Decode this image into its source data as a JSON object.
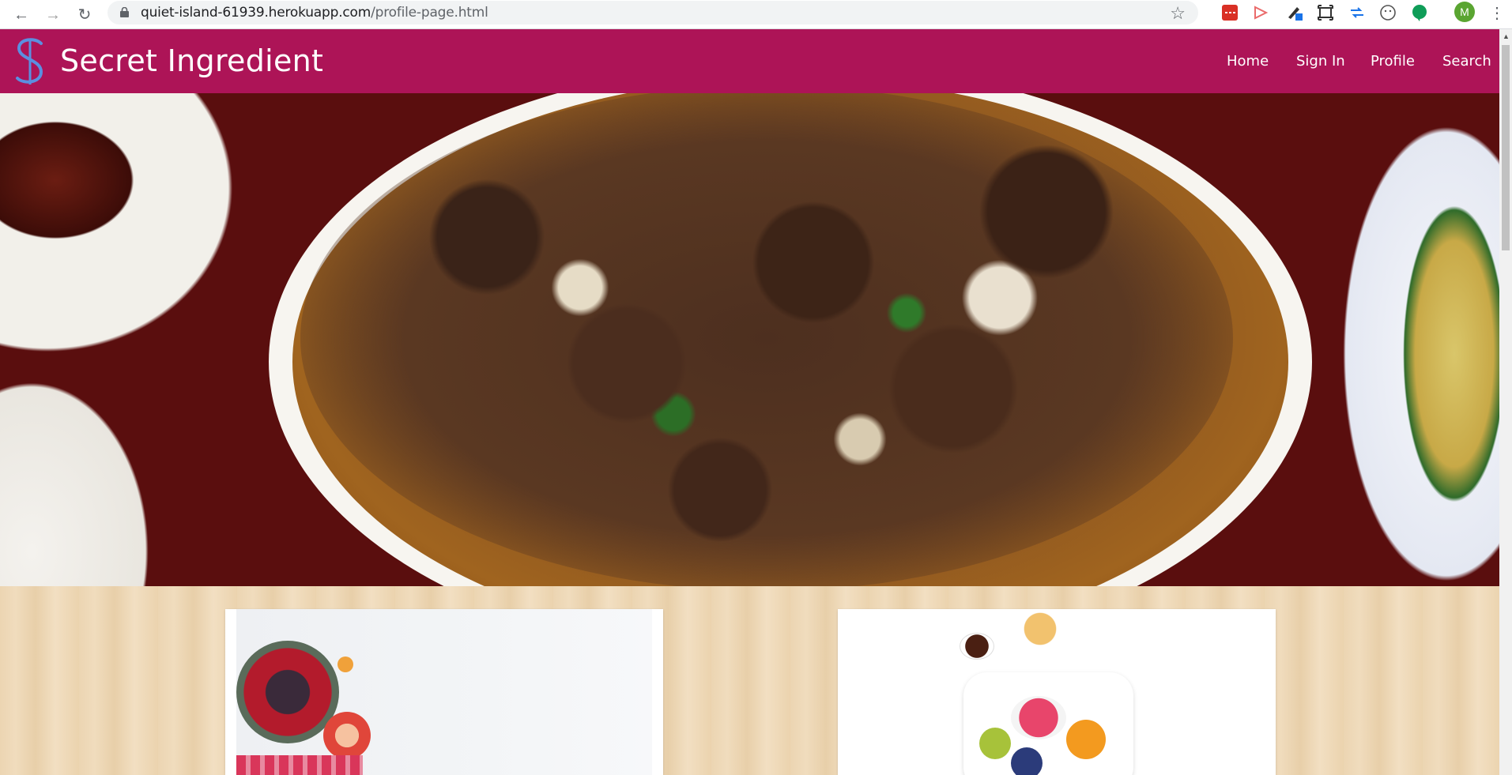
{
  "browser": {
    "url_host": "quiet-island-61939.herokuapp.com",
    "url_path": "/profile-page.html",
    "avatar_letter": "M",
    "icons": [
      "back-arrow-icon",
      "forward-arrow-icon",
      "reload-icon",
      "lock-icon",
      "star-icon"
    ]
  },
  "site": {
    "brand": "Secret Ingredient",
    "logo_letter": "S",
    "nav": {
      "home": "Home",
      "sign_in": "Sign In",
      "profile": "Profile",
      "search": "Search"
    },
    "colors": {
      "header": "#ad1457",
      "logo": "#5b8fe0",
      "background": "#ecd5b2"
    }
  }
}
